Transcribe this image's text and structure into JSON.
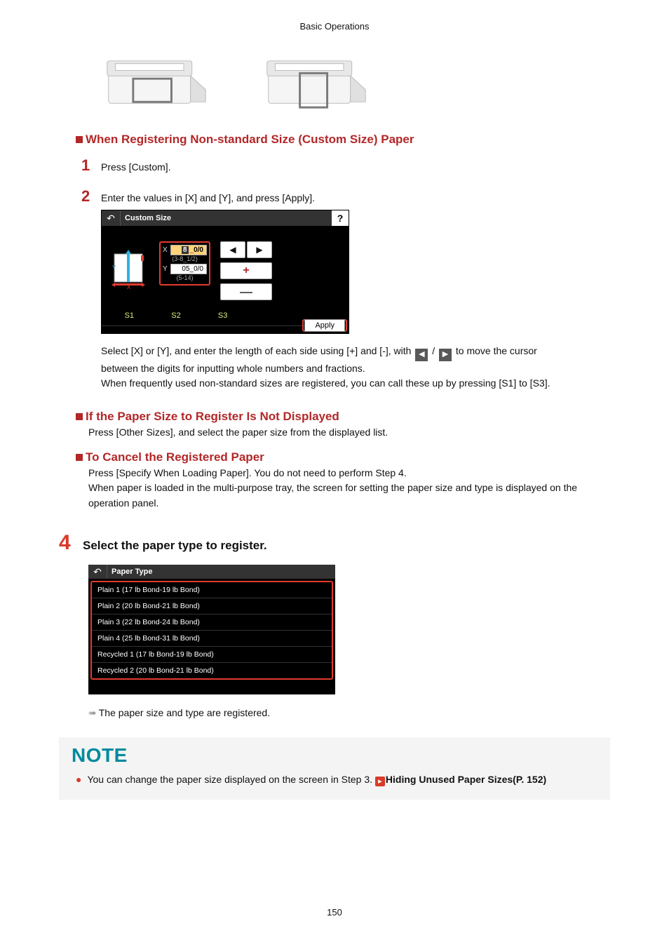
{
  "page": {
    "header": "Basic Operations",
    "number": "150"
  },
  "section_custom": {
    "title": "When Registering Non-standard Size (Custom Size) Paper",
    "step1": {
      "num": "1",
      "text": "Press [Custom]."
    },
    "step2": {
      "num": "2",
      "text": "Enter the values in [X] and [Y], and press [Apply]."
    }
  },
  "screen1": {
    "title": "Custom Size",
    "help": "?",
    "x_label": "X",
    "y_label": "Y",
    "x_value": "8_0/0",
    "x_range": "(3-8_1/2)",
    "y_value": "05_0/0",
    "y_range": "(5-14)",
    "s1": "S1",
    "s2": "S2",
    "s3": "S3",
    "apply": "Apply"
  },
  "explain1": {
    "line_pre": "Select [X] or [Y], and enter the length of each side using [+] and [-], with ",
    "line_mid": " / ",
    "line_post": " to move the cursor",
    "line2": "between the digits for inputting whole numbers and fractions.",
    "line3": "When frequently used non-standard sizes are registered, you can call these up by pressing [S1] to [S3]."
  },
  "section_notdisplayed": {
    "title": "If the Paper Size to Register Is Not Displayed",
    "text": "Press [Other Sizes], and select the paper size from the displayed list."
  },
  "section_cancel": {
    "title": "To Cancel the Registered Paper",
    "line1": "Press [Specify When Loading Paper]. You do not need to perform Step 4.",
    "line2": "When paper is loaded in the multi-purpose tray, the screen for setting the paper size and type is displayed on the operation panel."
  },
  "step4": {
    "num": "4",
    "text": "Select the paper type to register."
  },
  "screen2": {
    "title": "Paper Type",
    "items": [
      "Plain 1 (17 lb Bond-19 lb Bond)",
      "Plain 2 (20 lb Bond-21 lb Bond)",
      "Plain 3 (22 lb Bond-24 lb Bond)",
      "Plain 4 (25 lb Bond-31 lb Bond)",
      "Recycled 1 (17 lb Bond-19 lb Bond)",
      "Recycled 2 (20 lb Bond-21 lb Bond)"
    ]
  },
  "result_line": "The paper size and type are registered.",
  "note": {
    "heading": "NOTE",
    "text_pre": "You can change the paper size displayed on the screen in Step 3. ",
    "link": "Hiding Unused Paper Sizes(P. 152)"
  }
}
